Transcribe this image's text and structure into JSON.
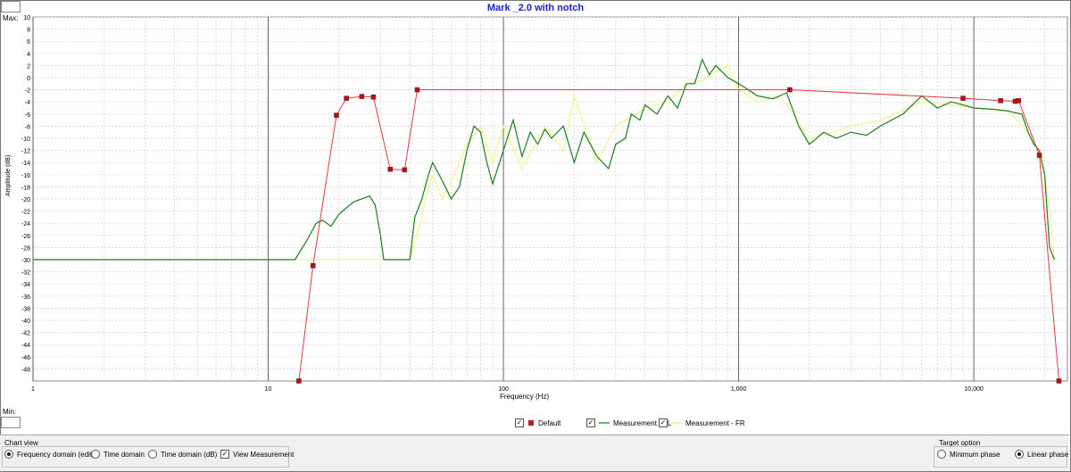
{
  "chart_data": {
    "type": "line",
    "title": "Mark _2.0 with notch",
    "xlabel": "Frequency (Hz)",
    "ylabel": "Amplitude (dB)",
    "xscale": "log",
    "xlim": [
      1,
      25000
    ],
    "ylim": [
      -50,
      10
    ],
    "grid": true,
    "legend_position": "bottom-center",
    "x_ticks": [
      1,
      10,
      100,
      1000,
      10000
    ],
    "x_tick_labels": [
      "1",
      "10",
      "100",
      "1,000",
      "10,000"
    ],
    "y_ticks": [
      10,
      8,
      6,
      4,
      2,
      0,
      -2,
      -4,
      -6,
      -8,
      -10,
      -12,
      -14,
      -16,
      -18,
      -20,
      -22,
      -24,
      -26,
      -28,
      -30,
      -32,
      -34,
      -36,
      -38,
      -40,
      -42,
      -44,
      -46,
      -48
    ],
    "series": [
      {
        "name": "Default",
        "color": "#e0383e",
        "marker": "square",
        "x": [
          13.5,
          15.5,
          19.5,
          21.5,
          25,
          28,
          33,
          38,
          43,
          1650,
          9000,
          13000,
          15000,
          15500,
          19000,
          23000
        ],
        "y": [
          -50,
          -31,
          -6.2,
          -3.4,
          -3.1,
          -3.2,
          -15.1,
          -15.2,
          -2.0,
          -2.0,
          -3.4,
          -3.8,
          -3.9,
          -3.8,
          -12.8,
          -50
        ]
      },
      {
        "name": "Measurement - FL",
        "color": "#1e7a1e",
        "x": [
          1,
          13,
          14.5,
          16,
          17,
          18.5,
          20,
          23,
          27,
          28.5,
          30,
          31,
          32,
          38,
          40,
          42,
          45,
          48,
          50,
          55,
          60,
          65,
          70,
          75,
          80,
          85,
          90,
          100,
          110,
          120,
          130,
          140,
          150,
          160,
          180,
          200,
          220,
          250,
          280,
          300,
          330,
          350,
          380,
          400,
          450,
          500,
          550,
          600,
          650,
          700,
          750,
          800,
          900,
          1000,
          1100,
          1200,
          1400,
          1600,
          1800,
          2000,
          2300,
          2600,
          3000,
          3500,
          4000,
          5000,
          6000,
          7000,
          8000,
          9000,
          10000,
          12000,
          14000,
          15000,
          16000,
          17000,
          18000,
          19000,
          20000,
          21000,
          22000
        ],
        "y": [
          -30,
          -30,
          -27,
          -24,
          -23.5,
          -24.5,
          -22.5,
          -20.5,
          -19.5,
          -21,
          -26,
          -30,
          -30,
          -30,
          -30,
          -23,
          -20,
          -16,
          -14,
          -17,
          -20,
          -18,
          -12,
          -8,
          -9,
          -14,
          -17.5,
          -12,
          -7,
          -13,
          -9,
          -11,
          -8.5,
          -10,
          -8,
          -14,
          -9,
          -13,
          -15,
          -11,
          -10,
          -6,
          -7,
          -4.5,
          -6,
          -3,
          -5,
          -1,
          -1,
          3,
          0.5,
          2,
          0,
          -1,
          -2,
          -3,
          -3.5,
          -2.5,
          -8,
          -11,
          -9,
          -10,
          -9,
          -9.5,
          -8,
          -6,
          -3,
          -5,
          -4,
          -4.5,
          -5,
          -5.2,
          -5.5,
          -5.8,
          -6,
          -9,
          -11,
          -12,
          -16,
          -28,
          -30
        ]
      },
      {
        "name": "Measurement - FR",
        "color": "#f4f48a",
        "x": [
          1,
          13,
          16,
          20,
          25,
          30,
          38,
          40,
          42,
          45,
          48,
          50,
          55,
          60,
          65,
          70,
          80,
          90,
          100,
          120,
          150,
          180,
          200,
          250,
          300,
          400,
          500,
          600,
          700,
          800,
          900,
          1000,
          1200,
          1500,
          2000,
          2500,
          3000,
          4000,
          6000,
          8000,
          10000,
          14000,
          18000,
          20000,
          21000,
          22000
        ],
        "y": [
          -30,
          -30,
          -30,
          -30,
          -30,
          -30,
          -30,
          -30,
          -27,
          -23,
          -18,
          -16,
          -20,
          -17,
          -14,
          -11,
          -8,
          -14,
          -8,
          -15,
          -8,
          -12,
          -3,
          -14,
          -8,
          -5,
          -4,
          -1,
          -0.5,
          1,
          2,
          -2,
          -4,
          -3,
          -10,
          -9,
          -8,
          -7,
          -4,
          -4.5,
          -5,
          -5.5,
          -10,
          -16,
          -22,
          -30
        ]
      }
    ]
  },
  "ui": {
    "max_label": "Max:",
    "min_label": "Min:",
    "chart_view_title": "Chart view",
    "frequency_domain_label": "Frequency domain (edit)",
    "time_domain_label": "Time domain",
    "time_domain_db_label": "Time domain (dB)",
    "view_measurement_label": "View Measurement",
    "target_option_title": "Target option",
    "minimum_phase_label": "Minimum phase",
    "linear_phase_label": "Linear phase",
    "selected_view": "Frequency domain (edit)",
    "selected_target": "Linear phase",
    "view_measurement_checked": true
  }
}
